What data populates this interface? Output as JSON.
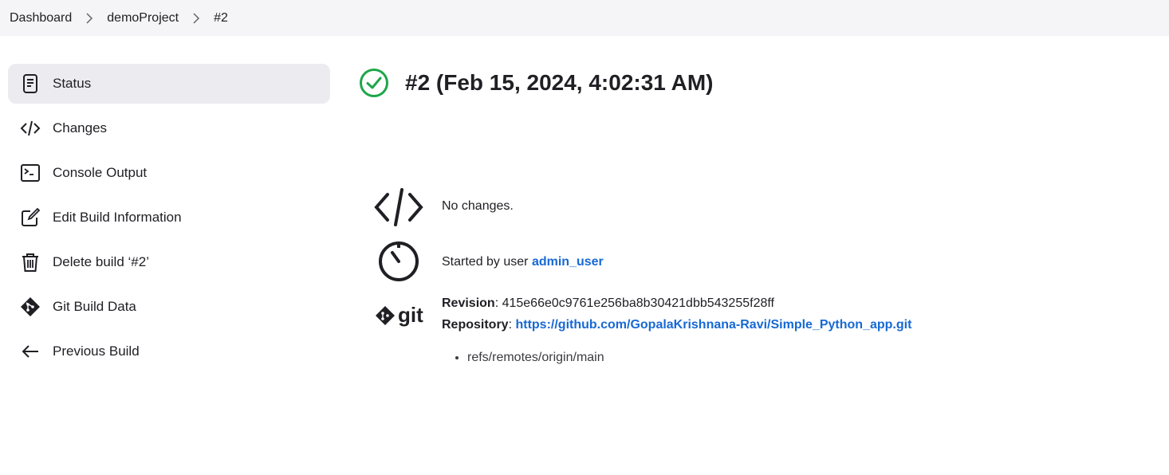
{
  "breadcrumb": {
    "items": [
      "Dashboard",
      "demoProject",
      "#2"
    ]
  },
  "sidebar": {
    "items": [
      {
        "label": "Status",
        "icon": "document-icon",
        "active": true
      },
      {
        "label": "Changes",
        "icon": "code-icon"
      },
      {
        "label": "Console Output",
        "icon": "terminal-icon"
      },
      {
        "label": "Edit Build Information",
        "icon": "edit-icon"
      },
      {
        "label": "Delete build ‘#2’",
        "icon": "trash-icon"
      },
      {
        "label": "Git Build Data",
        "icon": "git-icon"
      },
      {
        "label": "Previous Build",
        "icon": "arrow-left-icon"
      }
    ]
  },
  "main": {
    "title": "#2 (Feb 15, 2024, 4:02:31 AM)",
    "status_color": "#1ea64a",
    "changes_text": "No changes.",
    "started_prefix": "Started by user ",
    "started_user": "admin_user",
    "revision_label": "Revision",
    "revision_value": ": 415e66e0c9761e256ba8b30421dbb543255f28ff",
    "repository_label": "Repository",
    "repository_sep": ": ",
    "repository_url": "https://github.com/GopalaKrishnana-Ravi/Simple_Python_app.git",
    "refs": [
      "refs/remotes/origin/main"
    ],
    "git_logo_text": "git"
  },
  "colors": {
    "link": "#1769d4",
    "breadcrumb_bg": "#f5f5f7",
    "active_bg": "#ebebf0"
  }
}
